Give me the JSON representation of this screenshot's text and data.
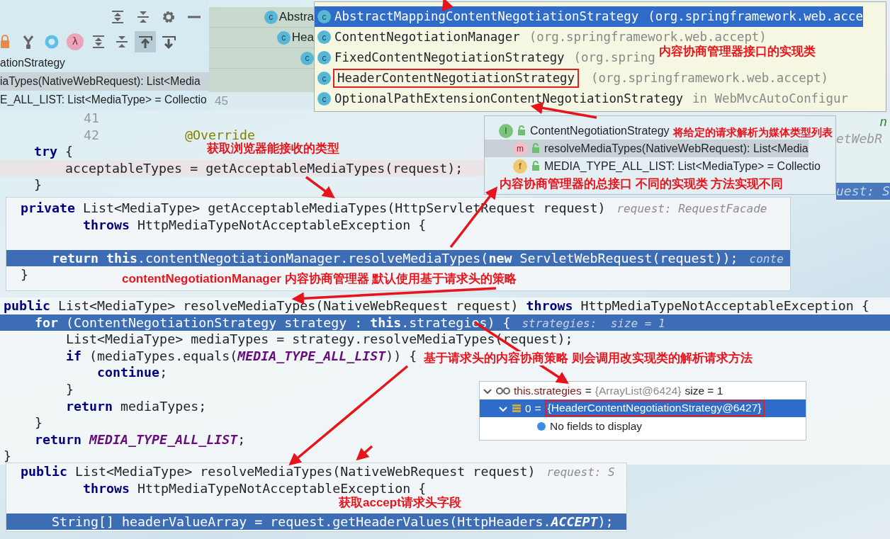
{
  "structure_panel": {
    "toolbar_top": [
      {
        "kind": "expand",
        "selected": false
      },
      {
        "kind": "collapse",
        "selected": false
      },
      {
        "kind": "gear",
        "selected": false
      },
      {
        "kind": "minimize",
        "selected": false
      }
    ],
    "toolbar": [
      {
        "kind": "lock",
        "selected": false
      },
      {
        "kind": "fork",
        "selected": false
      },
      {
        "kind": "ring",
        "selected": false
      },
      {
        "kind": "lambda",
        "glyph": "λ",
        "selected": false
      },
      {
        "kind": "expand",
        "selected": false
      },
      {
        "kind": "collapse",
        "selected": false
      },
      {
        "kind": "scroll-to",
        "selected": true
      },
      {
        "kind": "scroll-from",
        "selected": false
      }
    ],
    "rows": [
      {
        "text": "ationStrategy",
        "selected": false
      },
      {
        "text": "iaTypes(NativeWebRequest): List<Media",
        "selected": true
      },
      {
        "text": "E_ALL_LIST: List<MediaType> = Collectio",
        "selected": false
      }
    ]
  },
  "tab_list": {
    "items": [
      {
        "badge": "c",
        "text": "Abstra"
      },
      {
        "badge": "c",
        "text": "Hea"
      },
      {
        "badge": "c"
      }
    ]
  },
  "gutter_number": "45",
  "background_editor": {
    "lines": [
      {
        "number": "41"
      },
      {
        "number": "42",
        "tokens": [
          {
            "kind": "ann",
            "text": "           @Override"
          }
        ]
      },
      {
        "tokens": [
          {
            "kind": "kw",
            "text": "  try"
          },
          {
            "kind": "plain",
            "text": " {"
          }
        ]
      },
      {
        "highlighted": true,
        "tokens": [
          {
            "kind": "plain",
            "text": "      acceptableTypes = getAcceptableMediaTypes(request);"
          }
        ]
      },
      {
        "tokens": [
          {
            "kind": "plain",
            "text": "  }"
          }
        ]
      }
    ]
  },
  "right_strip": {
    "lines": [
      {
        "text": "n",
        "kind": "green"
      },
      {
        "text": "etWebR",
        "kind": "hint"
      },
      {
        "text": "uest: S",
        "kind": "hint-bar"
      }
    ]
  },
  "class_popup": {
    "items": [
      {
        "badge": "c",
        "name": "AbstractMappingContentNegotiationStrategy",
        "package": "(org.springframework.web.acce",
        "selected": true,
        "framed": false
      },
      {
        "badge": "c",
        "name": "ContentNegotiationManager",
        "package": "(org.springframework.web.accept)",
        "selected": false,
        "framed": false
      },
      {
        "badge": "c",
        "name": "FixedContentNegotiationStrategy",
        "package": "(org.spring",
        "selected": false,
        "framed": false
      },
      {
        "badge": "c",
        "name": "HeaderContentNegotiationStrategy",
        "package": "(org.springframework.web.accept)",
        "selected": false,
        "framed": true
      },
      {
        "badge": "c",
        "name": "OptionalPathExtensionContentNegotiationStrategy",
        "package": "in WebMvcAutoConfigur",
        "selected": false,
        "framed": false
      }
    ]
  },
  "hierarchy_popup": {
    "rows": [
      {
        "kind": "interface",
        "badge": "I",
        "text": "ContentNegotiationStrategy",
        "selected": false
      },
      {
        "kind": "method",
        "badge": "m",
        "text": "resolveMediaTypes(NativeWebRequest): List<Media",
        "selected": true
      },
      {
        "kind": "field",
        "badge": "f",
        "text": "MEDIA_TYPE_ALL_LIST: List<MediaType> = Collectio",
        "selected": false
      }
    ]
  },
  "code_panels": [
    {
      "lines": [
        {
          "highlighted": false,
          "hint": "request: RequestFacade",
          "tokens": [
            {
              "kind": "kw",
              "text": "private"
            },
            {
              "kind": "plain",
              "text": " List<MediaType> getAcceptableMediaTypes(HttpServletRequest request)"
            }
          ]
        },
        {
          "highlighted": false,
          "tokens": [
            {
              "kind": "kw",
              "text": "        throws"
            },
            {
              "kind": "plain",
              "text": " HttpMediaTypeNotAcceptableException {"
            }
          ]
        },
        {
          "highlighted": false
        },
        {
          "highlighted": true,
          "hint": "conte",
          "tokens": [
            {
              "kind": "kw",
              "text": "    return this"
            },
            {
              "kind": "plain",
              "text": ".contentNegotiationManager.resolveMediaTypes("
            },
            {
              "kind": "kw",
              "text": "new"
            },
            {
              "kind": "plain",
              "text": " ServletWebRequest(request));"
            }
          ]
        },
        {
          "highlighted": false,
          "tokens": [
            {
              "kind": "plain",
              "text": "}"
            }
          ]
        }
      ]
    },
    {
      "lines": [
        {
          "highlighted": false,
          "tokens": [
            {
              "kind": "kw",
              "text": "public"
            },
            {
              "kind": "plain",
              "text": " List<MediaType> resolveMediaTypes(NativeWebRequest request) "
            },
            {
              "kind": "kw",
              "text": "throws"
            },
            {
              "kind": "plain",
              "text": " HttpMediaTypeNotAcceptableException {"
            }
          ]
        },
        {
          "highlighted": true,
          "hint": "strategies:  size = 1",
          "tokens": [
            {
              "kind": "kw",
              "text": "    for"
            },
            {
              "kind": "plain",
              "text": " (ContentNegotiationStrategy strategy : "
            },
            {
              "kind": "kw",
              "text": "this"
            },
            {
              "kind": "plain",
              "text": ".strategies) {"
            }
          ]
        },
        {
          "highlighted": false,
          "tokens": [
            {
              "kind": "plain",
              "text": "        List<MediaType> mediaTypes = strategy.resolveMediaTypes(request);"
            }
          ]
        },
        {
          "highlighted": false,
          "tokens": [
            {
              "kind": "kw",
              "text": "        if"
            },
            {
              "kind": "plain",
              "text": " (mediaTypes.equals("
            },
            {
              "kind": "const",
              "text": "MEDIA_TYPE_ALL_LIST"
            },
            {
              "kind": "plain",
              "text": ")) {"
            }
          ]
        },
        {
          "highlighted": false,
          "tokens": [
            {
              "kind": "kw",
              "text": "            continue"
            },
            {
              "kind": "plain",
              "text": ";"
            }
          ]
        },
        {
          "highlighted": false,
          "tokens": [
            {
              "kind": "plain",
              "text": "        }"
            }
          ]
        },
        {
          "highlighted": false,
          "tokens": [
            {
              "kind": "kw",
              "text": "        return"
            },
            {
              "kind": "plain",
              "text": " mediaTypes;"
            }
          ]
        },
        {
          "highlighted": false,
          "tokens": [
            {
              "kind": "plain",
              "text": "    }"
            }
          ]
        },
        {
          "highlighted": false,
          "tokens": [
            {
              "kind": "kw",
              "text": "    return"
            },
            {
              "kind": "const",
              "text": " MEDIA_TYPE_ALL_LIST"
            },
            {
              "kind": "plain",
              "text": ";"
            }
          ]
        },
        {
          "highlighted": false,
          "tokens": [
            {
              "kind": "plain",
              "text": "}"
            }
          ]
        }
      ]
    },
    {
      "lines": [
        {
          "highlighted": false,
          "hint": "request: S",
          "tokens": [
            {
              "kind": "kw",
              "text": "public"
            },
            {
              "kind": "plain",
              "text": " List<MediaType> resolveMediaTypes(NativeWebRequest request)"
            }
          ]
        },
        {
          "highlighted": false,
          "tokens": [
            {
              "kind": "kw",
              "text": "        throws"
            },
            {
              "kind": "plain",
              "text": " HttpMediaTypeNotAcceptableException {"
            }
          ]
        },
        {
          "highlighted": false
        },
        {
          "highlighted": true,
          "tokens": [
            {
              "kind": "plain",
              "text": "    String[] headerValueArray = request.getHeaderValues(HttpHeaders."
            },
            {
              "kind": "const",
              "text": "ACCEPT"
            },
            {
              "kind": "plain",
              "text": ");"
            }
          ]
        }
      ]
    }
  ],
  "debug_popup": {
    "rows": [
      {
        "expanded": true,
        "selected": false,
        "name": "this.strategies",
        "operator": "=",
        "value": "{ArrayList@6424}",
        "extra": "size = 1",
        "framed": false
      },
      {
        "expanded": true,
        "selected": true,
        "name": "0",
        "operator": "=",
        "value": "{HeaderContentNegotiationStrategy@6427}",
        "framed": true
      }
    ],
    "empty_note": "No fields to display"
  },
  "annotations": [
    {
      "text": "内容协商管理器接口的实现类"
    },
    {
      "text": "将给定的请求解析为媒体类型列表"
    },
    {
      "text": "获取浏览器能接收的类型"
    },
    {
      "text": "内容协商管理器的总接口  不同的实现类 方法实现不同"
    },
    {
      "text": "contentNegotiationManager 内容协商管理器  默认使用基于请求头的策略"
    },
    {
      "text": "基于请求头的内容协商策略  则会调用改实现类的解析请求方法"
    },
    {
      "text": "获取accept请求头字段"
    }
  ]
}
